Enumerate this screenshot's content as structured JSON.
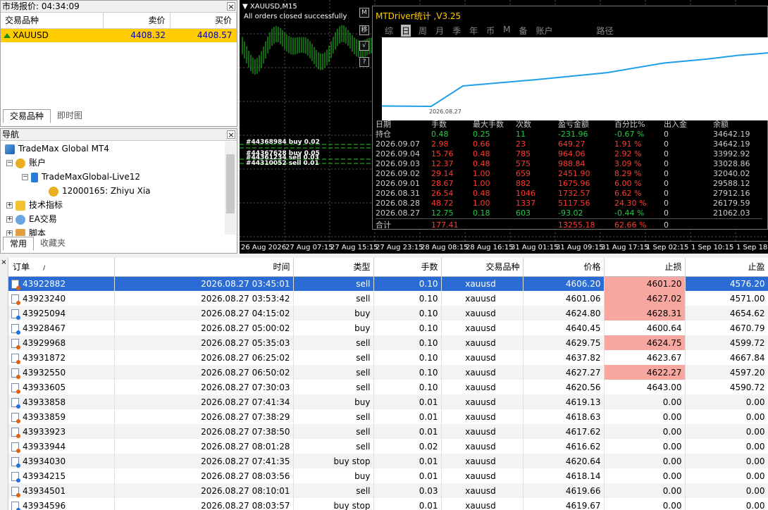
{
  "market_watch": {
    "title": "市场报价: 04:34:09",
    "columns": [
      "交易品种",
      "卖价",
      "买价"
    ],
    "rows": [
      {
        "symbol": "XAUUSD",
        "bid": "4408.32",
        "ask": "4408.57"
      }
    ],
    "tabs": [
      "交易品种",
      "即时图"
    ]
  },
  "navigator": {
    "title": "导航",
    "items": [
      "TradeMax Global MT4",
      "账户",
      "TradeMaxGlobal-Live12",
      "12000165: Zhiyu Xia",
      "技术指标",
      "EA交易",
      "脚本"
    ],
    "tabs": [
      "常用",
      "收藏夹"
    ]
  },
  "chart": {
    "title": "XAUUSD,M15",
    "message": "All orders closed successfully",
    "order_labels": [
      "#44368984 buy 0.02",
      "#44367628 buy 0.05",
      "#44361234 sell 0.03",
      "#44310052 sell 0.01"
    ],
    "side_buttons": [
      "M",
      "移",
      "√",
      "?"
    ],
    "time_axis": [
      "26 Aug 2026",
      "27 Aug 07:15",
      "27 Aug 15:15",
      "27 Aug 23:15",
      "28 Aug 08:15",
      "28 Aug 16:15",
      "31 Aug 01:15",
      "31 Aug 09:15",
      "31 Aug 17:15",
      "1 Sep 02:15",
      "1 Sep 10:15",
      "1 Sep 18:1"
    ],
    "candle_color": "#22cc22"
  },
  "mtdriver": {
    "title": "MTDriver统计 ,V3.25",
    "tabs": [
      "综",
      "日",
      "周",
      "月",
      "季",
      "年",
      "币",
      "M",
      "备",
      "账户",
      "路径"
    ],
    "active_tab": "日",
    "graph_label": "2026.08.27",
    "headers": [
      "日期",
      "手数",
      "最大手数",
      "次数",
      "盈亏金额",
      "百分比%",
      "出入金",
      "余额"
    ],
    "rows": [
      {
        "date": "持仓",
        "lots": "0.48",
        "max": "0.25",
        "count": "11",
        "pnl": "-231.96",
        "pct": "-0.67 %",
        "flow": "0",
        "balance": "34642.19",
        "tone": "g"
      },
      {
        "date": "2026.09.07",
        "lots": "2.98",
        "max": "0.66",
        "count": "23",
        "pnl": "649.27",
        "pct": "1.91 %",
        "flow": "0",
        "balance": "34642.19",
        "tone": "r"
      },
      {
        "date": "2026.09.04",
        "lots": "15.76",
        "max": "0.48",
        "count": "785",
        "pnl": "964.06",
        "pct": "2.92 %",
        "flow": "0",
        "balance": "33992.92",
        "tone": "r"
      },
      {
        "date": "2026.09.03",
        "lots": "12.37",
        "max": "0.48",
        "count": "575",
        "pnl": "988.84",
        "pct": "3.09 %",
        "flow": "0",
        "balance": "33028.86",
        "tone": "r"
      },
      {
        "date": "2026.09.02",
        "lots": "29.14",
        "max": "1.00",
        "count": "659",
        "pnl": "2451.90",
        "pct": "8.29 %",
        "flow": "0",
        "balance": "32040.02",
        "tone": "r"
      },
      {
        "date": "2026.09.01",
        "lots": "28.67",
        "max": "1.00",
        "count": "882",
        "pnl": "1675.96",
        "pct": "6.00 %",
        "flow": "0",
        "balance": "29588.12",
        "tone": "r"
      },
      {
        "date": "2026.08.31",
        "lots": "26.54",
        "max": "0.48",
        "count": "1046",
        "pnl": "1732.57",
        "pct": "6.62 %",
        "flow": "0",
        "balance": "27912.16",
        "tone": "r"
      },
      {
        "date": "2026.08.28",
        "lots": "48.72",
        "max": "1.00",
        "count": "1337",
        "pnl": "5117.56",
        "pct": "24.30 %",
        "flow": "0",
        "balance": "26179.59",
        "tone": "r"
      },
      {
        "date": "2026.08.27",
        "lots": "12.75",
        "max": "0.18",
        "count": "603",
        "pnl": "-93.02",
        "pct": "-0.44 %",
        "flow": "0",
        "balance": "21062.03",
        "tone": "g"
      }
    ],
    "total": {
      "date": "合计",
      "lots": "177.41",
      "pnl": "13255.18",
      "pct": "62.66 %",
      "flow": "0"
    },
    "equity_curve": [
      21062.03,
      20969.01,
      26179.59,
      27912.16,
      29588.12,
      32040.02,
      33028.86,
      33992.92,
      34642.19
    ]
  },
  "orders": {
    "columns": [
      "订单",
      "时间",
      "类型",
      "手数",
      "交易品种",
      "价格",
      "止损",
      "止盈"
    ],
    "sort_mark": "/",
    "rows": [
      {
        "id": "43922882",
        "time": "2026.08.27 03:45:01",
        "type": "sell",
        "lots": "0.10",
        "symbol": "xauusd",
        "price": "4606.20",
        "sl": "4601.20",
        "tp": "4576.20",
        "sl_hit": true
      },
      {
        "id": "43923240",
        "time": "2026.08.27 03:53:42",
        "type": "sell",
        "lots": "0.10",
        "symbol": "xauusd",
        "price": "4601.06",
        "sl": "4627.02",
        "tp": "4571.00",
        "sl_hit": true
      },
      {
        "id": "43925094",
        "time": "2026.08.27 04:15:02",
        "type": "buy",
        "lots": "0.10",
        "symbol": "xauusd",
        "price": "4624.80",
        "sl": "4628.31",
        "tp": "4654.62",
        "sl_hit": true
      },
      {
        "id": "43928467",
        "time": "2026.08.27 05:00:02",
        "type": "buy",
        "lots": "0.10",
        "symbol": "xauusd",
        "price": "4640.45",
        "sl": "4600.64",
        "tp": "4670.79",
        "sl_hit": false
      },
      {
        "id": "43929968",
        "time": "2026.08.27 05:35:03",
        "type": "sell",
        "lots": "0.10",
        "symbol": "xauusd",
        "price": "4629.75",
        "sl": "4624.75",
        "tp": "4599.72",
        "sl_hit": true
      },
      {
        "id": "43931872",
        "time": "2026.08.27 06:25:02",
        "type": "sell",
        "lots": "0.10",
        "symbol": "xauusd",
        "price": "4637.82",
        "sl": "4623.67",
        "tp": "4667.84",
        "sl_hit": false
      },
      {
        "id": "43932550",
        "time": "2026.08.27 06:50:02",
        "type": "sell",
        "lots": "0.10",
        "symbol": "xauusd",
        "price": "4627.27",
        "sl": "4622.27",
        "tp": "4597.20",
        "sl_hit": true
      },
      {
        "id": "43933605",
        "time": "2026.08.27 07:30:03",
        "type": "sell",
        "lots": "0.10",
        "symbol": "xauusd",
        "price": "4620.56",
        "sl": "4643.00",
        "tp": "4590.72",
        "sl_hit": false
      },
      {
        "id": "43933858",
        "time": "2026.08.27 07:41:34",
        "type": "buy",
        "lots": "0.01",
        "symbol": "xauusd",
        "price": "4619.13",
        "sl": "0.00",
        "tp": "0.00",
        "sl_hit": false
      },
      {
        "id": "43933859",
        "time": "2026.08.27 07:38:29",
        "type": "sell",
        "lots": "0.01",
        "symbol": "xauusd",
        "price": "4618.63",
        "sl": "0.00",
        "tp": "0.00",
        "sl_hit": false
      },
      {
        "id": "43933923",
        "time": "2026.08.27 07:38:50",
        "type": "sell",
        "lots": "0.01",
        "symbol": "xauusd",
        "price": "4617.62",
        "sl": "0.00",
        "tp": "0.00",
        "sl_hit": false
      },
      {
        "id": "43933944",
        "time": "2026.08.27 08:01:28",
        "type": "sell",
        "lots": "0.02",
        "symbol": "xauusd",
        "price": "4616.62",
        "sl": "0.00",
        "tp": "0.00",
        "sl_hit": false
      },
      {
        "id": "43934030",
        "time": "2026.08.27 07:41:35",
        "type": "buy stop",
        "lots": "0.01",
        "symbol": "xauusd",
        "price": "4620.64",
        "sl": "0.00",
        "tp": "0.00",
        "sl_hit": false
      },
      {
        "id": "43934215",
        "time": "2026.08.27 08:03:56",
        "type": "buy",
        "lots": "0.01",
        "symbol": "xauusd",
        "price": "4618.14",
        "sl": "0.00",
        "tp": "0.00",
        "sl_hit": false
      },
      {
        "id": "43934501",
        "time": "2026.08.27 08:10:01",
        "type": "sell",
        "lots": "0.03",
        "symbol": "xauusd",
        "price": "4619.66",
        "sl": "0.00",
        "tp": "0.00",
        "sl_hit": false
      },
      {
        "id": "43934596",
        "time": "2026.08.27 08:03:57",
        "type": "buy stop",
        "lots": "0.01",
        "symbol": "xauusd",
        "price": "4619.67",
        "sl": "0.00",
        "tp": "0.00",
        "sl_hit": false
      }
    ]
  }
}
